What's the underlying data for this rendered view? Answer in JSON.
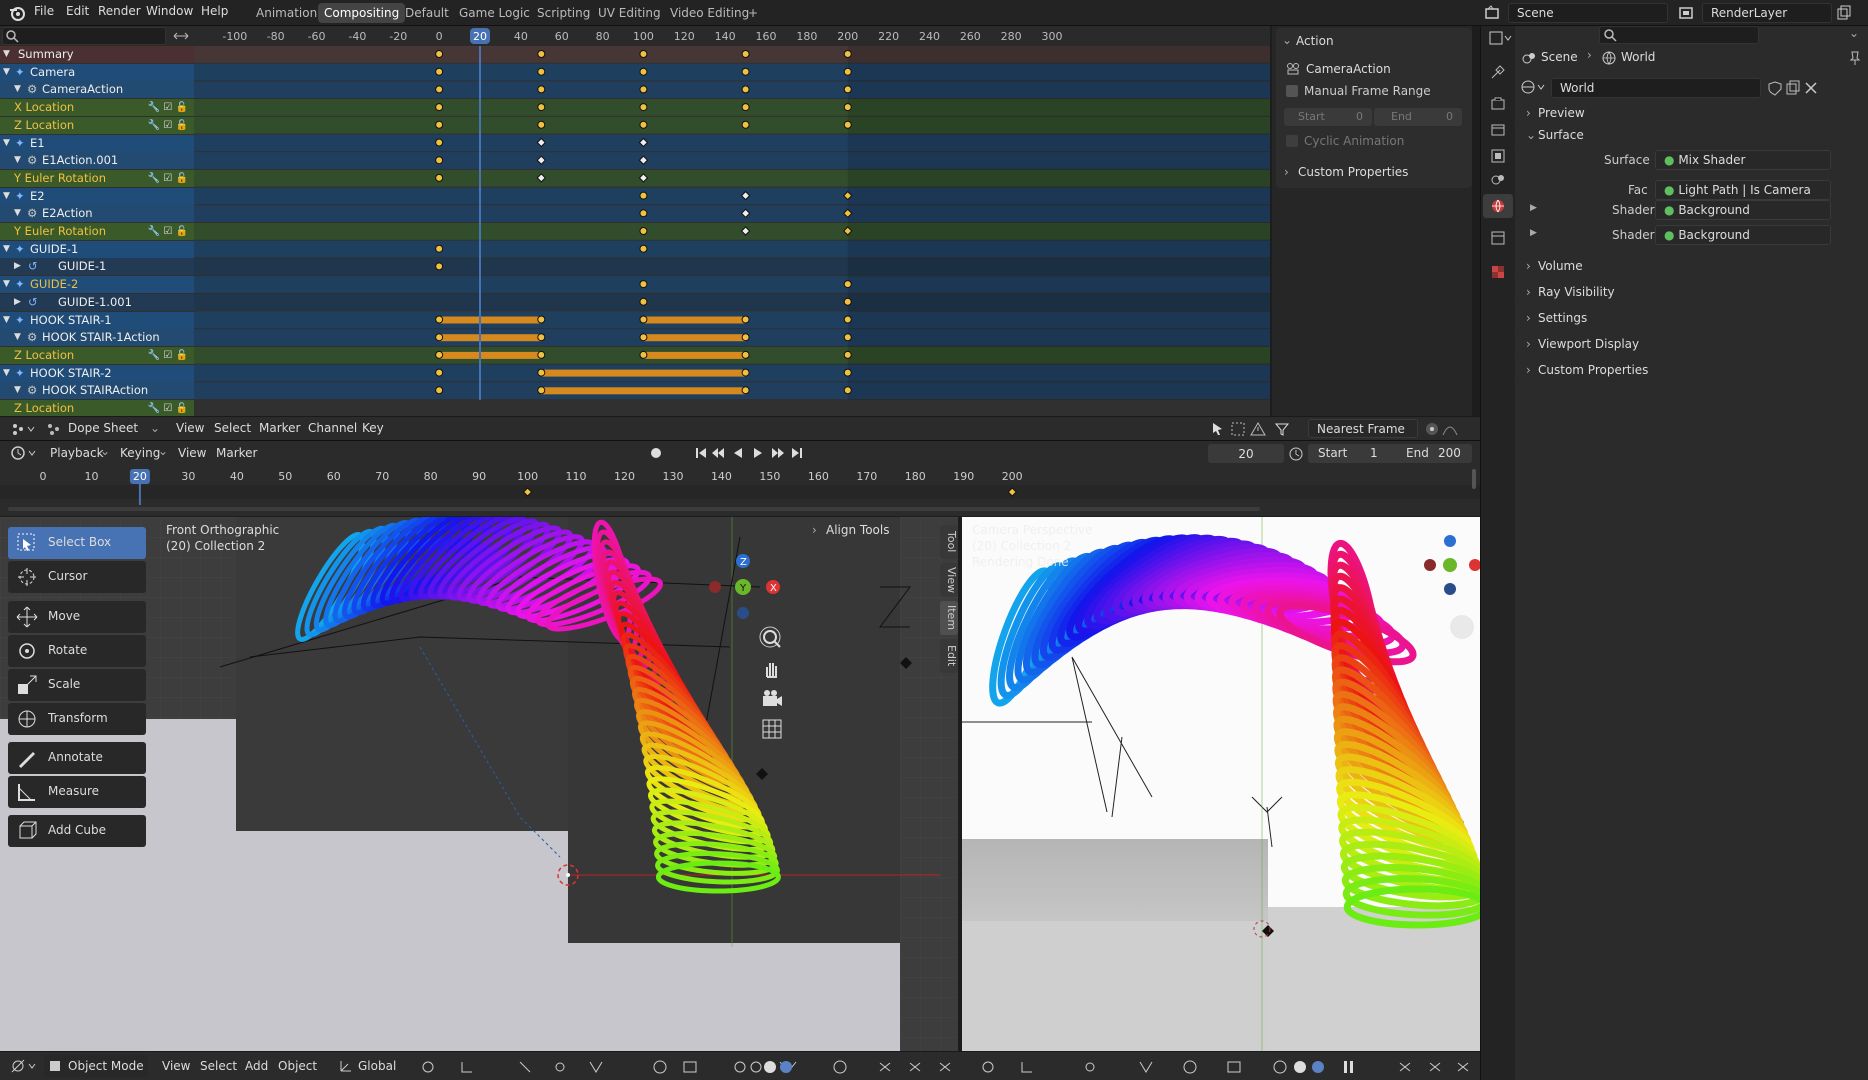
{
  "topbar": {
    "menus": [
      "File",
      "Edit",
      "Render",
      "Window",
      "Help"
    ],
    "workspaces": [
      "Animation",
      "Compositing",
      "Default",
      "Game Logic",
      "Scripting",
      "UV Editing",
      "Video Editing"
    ],
    "active_workspace": "Compositing",
    "add_tab": "+",
    "scene": "Scene",
    "render_layer": "RenderLayer"
  },
  "dopesheet": {
    "ruler": [
      "-100",
      "-80",
      "-60",
      "-40",
      "-20",
      "0",
      "20",
      "40",
      "60",
      "80",
      "100",
      "120",
      "140",
      "160",
      "180",
      "200",
      "220",
      "240",
      "260",
      "280",
      "300"
    ],
    "current_frame": "20",
    "channels": [
      {
        "label": "Summary",
        "kind": "summary"
      },
      {
        "label": "Camera",
        "kind": "object"
      },
      {
        "label": "CameraAction",
        "kind": "action"
      },
      {
        "label": "X Location",
        "kind": "fcurve"
      },
      {
        "label": "Z Location",
        "kind": "fcurve"
      },
      {
        "label": "E1",
        "kind": "object"
      },
      {
        "label": "E1Action.001",
        "kind": "action"
      },
      {
        "label": "Y Euler Rotation",
        "kind": "fcurve"
      },
      {
        "label": "E2",
        "kind": "object"
      },
      {
        "label": "E2Action",
        "kind": "action"
      },
      {
        "label": "Y Euler Rotation",
        "kind": "fcurve"
      },
      {
        "label": "GUIDE-1",
        "kind": "object"
      },
      {
        "label": "GUIDE-1",
        "kind": "sub"
      },
      {
        "label": "GUIDE-2",
        "kind": "object"
      },
      {
        "label": "GUIDE-1.001",
        "kind": "sub"
      },
      {
        "label": "HOOK STAIR-1",
        "kind": "object"
      },
      {
        "label": "HOOK STAIR-1Action",
        "kind": "action"
      },
      {
        "label": "Z Location",
        "kind": "fcurve"
      },
      {
        "label": "HOOK STAIR-2",
        "kind": "object"
      },
      {
        "label": "HOOK STAIRAction",
        "kind": "action"
      },
      {
        "label": "Z Location",
        "kind": "fcurve"
      }
    ],
    "keys": [
      [
        0,
        50,
        100,
        150,
        200
      ],
      [
        0,
        50,
        100,
        150,
        200
      ],
      [
        0,
        50,
        100,
        150,
        200
      ],
      [
        0,
        50,
        100,
        150,
        200
      ],
      [
        0,
        50,
        100,
        150,
        200
      ],
      [
        0,
        50,
        100
      ],
      [
        0,
        50,
        100
      ],
      [
        0,
        50,
        100
      ],
      [
        100,
        150,
        200
      ],
      [
        100,
        150,
        200
      ],
      [
        100,
        150,
        200
      ],
      [
        0,
        100
      ],
      [
        0
      ],
      [
        100,
        200
      ],
      [
        100,
        200
      ],
      [
        0,
        50,
        100,
        150,
        200
      ],
      [
        0,
        50,
        100,
        150,
        200
      ],
      [
        0,
        50,
        100,
        150,
        200
      ],
      [
        0,
        50,
        150,
        200
      ],
      [
        0,
        50,
        150,
        200
      ],
      [
        50,
        150
      ]
    ],
    "holds": [
      [
        15,
        0,
        50
      ],
      [
        15,
        100,
        150
      ],
      [
        16,
        0,
        50
      ],
      [
        16,
        100,
        150
      ],
      [
        17,
        0,
        50
      ],
      [
        17,
        100,
        150
      ],
      [
        18,
        50,
        150
      ],
      [
        19,
        50,
        150
      ]
    ],
    "header": {
      "editor": "Dope Sheet",
      "menus": [
        "View",
        "Select",
        "Marker",
        "Channel",
        "Key"
      ],
      "snap": "Nearest Frame"
    }
  },
  "action_panel": {
    "title": "Action",
    "action_name": "CameraAction",
    "manual_range": "Manual Frame Range",
    "start_label": "Start",
    "start_value": "0",
    "end_label": "End",
    "end_value": "0",
    "cyclic": "Cyclic Animation",
    "custom_props": "Custom Properties"
  },
  "timeline": {
    "menus": [
      "Playback",
      "Keying",
      "View",
      "Marker"
    ],
    "frame": "20",
    "start_label": "Start",
    "start": "1",
    "end_label": "End",
    "end": "200",
    "ticks": [
      "0",
      "10",
      "20",
      "30",
      "40",
      "50",
      "60",
      "70",
      "80",
      "90",
      "100",
      "110",
      "120",
      "130",
      "140",
      "150",
      "160",
      "170",
      "180",
      "190",
      "200"
    ],
    "markers": [
      100,
      200
    ]
  },
  "viewport_left": {
    "view_name": "Front Orthographic",
    "collection": "(20) Collection 2",
    "tools": [
      "Select Box",
      "Cursor",
      "Move",
      "Rotate",
      "Scale",
      "Transform",
      "Annotate",
      "Measure",
      "Add Cube"
    ],
    "align_tools": "Align Tools",
    "sidebar_tabs": [
      "Tool",
      "View",
      "Item",
      "Edit"
    ]
  },
  "viewport_right": {
    "view_name": "Camera Perspective",
    "collection": "(20) Collection 2",
    "status": "Rendering Done"
  },
  "bottom_header": {
    "mode": "Object Mode",
    "menus": [
      "View",
      "Select",
      "Add",
      "Object"
    ],
    "orientation": "Global"
  },
  "properties": {
    "breadcrumb_scene": "Scene",
    "breadcrumb_world": "World",
    "world_name": "World",
    "sections": [
      "Preview",
      "Surface",
      "Volume",
      "Ray Visibility",
      "Settings",
      "Viewport Display",
      "Custom Properties"
    ],
    "surface_label": "Surface",
    "surface_value": "Mix Shader",
    "fac_label": "Fac",
    "fac_value": "Light Path | Is Camera Ray",
    "shader_label": "Shader",
    "shader1": "Background",
    "shader2": "Background"
  }
}
